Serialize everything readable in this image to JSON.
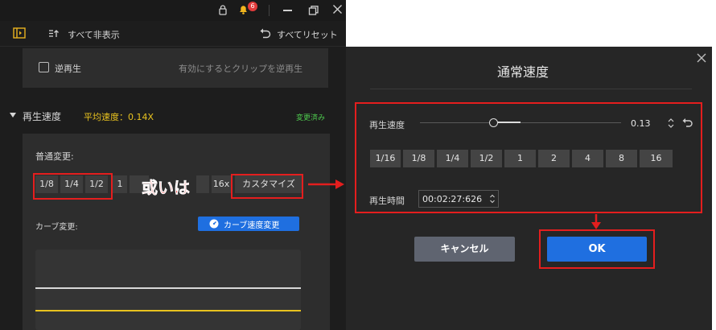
{
  "topbar": {
    "badge_count": "6"
  },
  "toolbar": {
    "hide_all_label": "すべて非表示",
    "reset_all_label": "すべてリセット"
  },
  "reverse": {
    "label": "逆再生",
    "hint": "有効にするとクリップを逆再生"
  },
  "speed_section": {
    "title": "再生速度",
    "average_label": "平均速度：0.14X",
    "changed_label": "変更済み"
  },
  "normal_change": {
    "label": "普通変更:",
    "buttons": [
      "1/8",
      "1/4",
      "1/2",
      "1",
      "",
      "",
      "16x"
    ],
    "customize_label": "カスタマイズ"
  },
  "annotation": {
    "or_label": "或いは"
  },
  "curve": {
    "label": "カーブ変更:",
    "button_label": "カーブ速度変更"
  },
  "dialog": {
    "title": "通常速度",
    "speed_label": "再生速度",
    "speed_value": "0.13",
    "speed_presets": [
      "1/16",
      "1/8",
      "1/4",
      "1/2",
      "1",
      "2",
      "4",
      "8",
      "16"
    ],
    "time_label": "再生時間",
    "time_value": "00:02:27:626",
    "cancel_label": "キャンセル",
    "ok_label": "OK"
  },
  "colors": {
    "accent_blue": "#1f6fe0",
    "yellow": "#e8c21f",
    "green": "#4ec94e",
    "annotation_red": "#e41e1e"
  }
}
